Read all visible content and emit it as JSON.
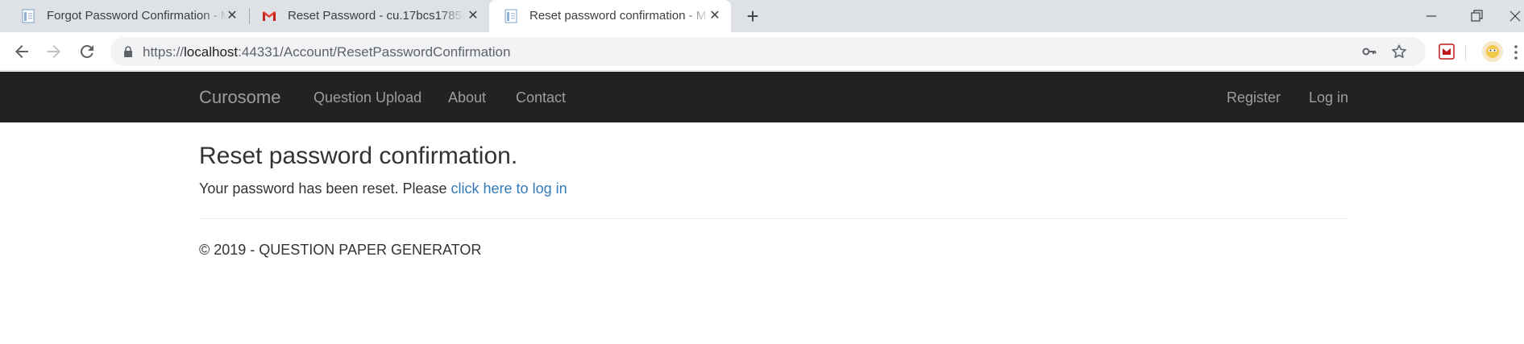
{
  "browser": {
    "tabs": [
      {
        "title": "Forgot Password Confirmation - M",
        "icon": "page-icon",
        "active": false
      },
      {
        "title": "Reset Password - cu.17bcs1785@",
        "icon": "gmail-icon",
        "active": false
      },
      {
        "title": "Reset password confirmation - M",
        "icon": "page-icon",
        "active": true
      }
    ],
    "close_glyph": "✕",
    "new_tab_glyph": "+",
    "url": {
      "scheme": "https://",
      "host": "localhost",
      "rest": ":44331/Account/ResetPasswordConfirmation"
    }
  },
  "navbar": {
    "brand": "Curosome",
    "links": [
      "Question Upload",
      "About",
      "Contact"
    ],
    "right_links": [
      "Register",
      "Log in"
    ]
  },
  "main": {
    "title": "Reset password confirmation.",
    "message": "Your password has been reset. Please ",
    "link_text": "click here to log in"
  },
  "footer": {
    "text": "© 2019 - QUESTION PAPER GENERATOR"
  },
  "colors": {
    "navbar_bg": "#222222",
    "navbar_text": "#9d9d9d",
    "link": "#337ab7",
    "tabstrip_bg": "#dee1e6"
  }
}
